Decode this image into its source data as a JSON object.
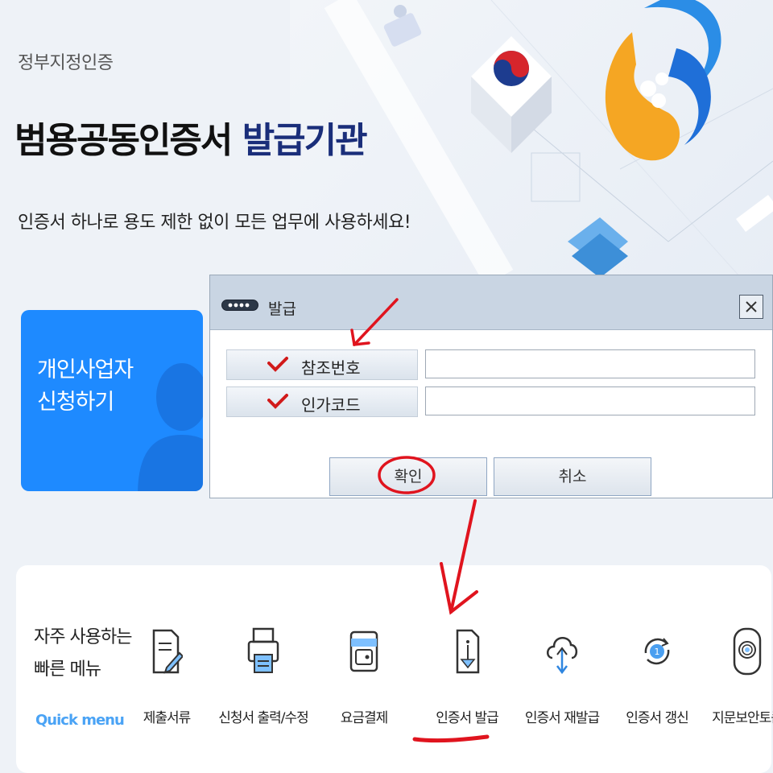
{
  "hero": {
    "subtitle": "정부지정인증",
    "headline_main": "범용공동인증서 ",
    "headline_highlight": "발급기관",
    "tagline": "인증서 하나로 용도 제한 없이 모든 업무에 사용하세요!"
  },
  "apply_card": {
    "label": "개인사업자\n신청하기"
  },
  "dialog": {
    "title": "발급",
    "fields": [
      {
        "label": "참조번호",
        "value": ""
      },
      {
        "label": "인가코드",
        "value": ""
      }
    ],
    "ok_label": "확인",
    "cancel_label": "취소"
  },
  "quick_menu": {
    "title": "자주 사용하는\n빠른 메뉴",
    "subtitle": "Quick menu",
    "items": [
      {
        "label": "제출서류",
        "icon": "document-pen-icon"
      },
      {
        "label": "신청서 출력/수정",
        "icon": "printer-icon"
      },
      {
        "label": "요금결제",
        "icon": "wallet-icon"
      },
      {
        "label": "인증서 발급",
        "icon": "certificate-download-icon"
      },
      {
        "label": "인증서 재발급",
        "icon": "cloud-sync-icon"
      },
      {
        "label": "인증서 갱신",
        "icon": "renew-icon"
      },
      {
        "label": "지문보안토큰",
        "icon": "fingerprint-token-icon"
      }
    ]
  },
  "colors": {
    "accent_blue": "#1e8aff",
    "headline_navy": "#1a2e7a",
    "quick_menu_blue": "#4aa3f5",
    "annotation_red": "#e0141e"
  }
}
